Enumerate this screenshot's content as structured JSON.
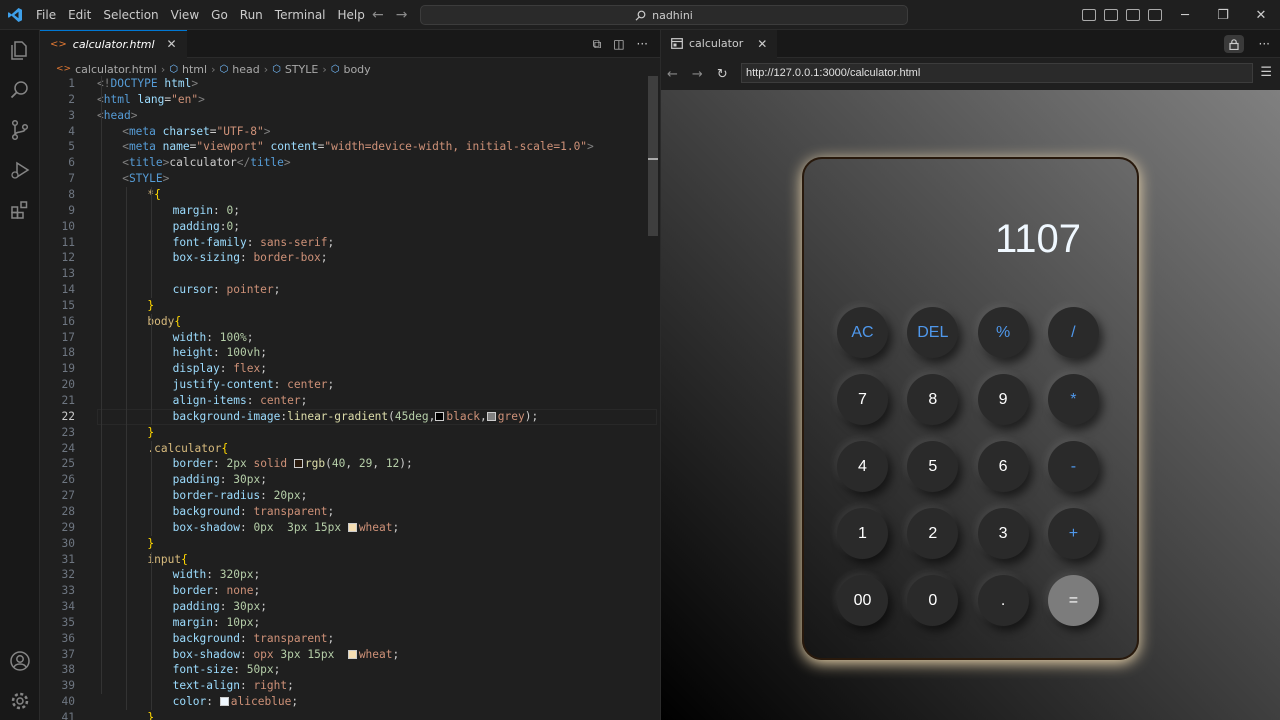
{
  "menu": [
    "File",
    "Edit",
    "Selection",
    "View",
    "Go",
    "Run",
    "Terminal",
    "Help"
  ],
  "command_center": {
    "label": "nadhini"
  },
  "editor": {
    "tab_label": "calculator.html",
    "breadcrumb": [
      "calculator.html",
      "html",
      "head",
      "STYLE",
      "body"
    ],
    "active_line": 22,
    "lines": [
      {
        "n": 1,
        "i": 0,
        "t": [
          [
            "t-punc",
            "<!"
          ],
          [
            "t-tag",
            "DOCTYPE"
          ],
          [
            "t-txt",
            " "
          ],
          [
            "t-attr",
            "html"
          ],
          [
            "t-punc",
            ">"
          ]
        ]
      },
      {
        "n": 2,
        "i": 0,
        "t": [
          [
            "t-punc",
            "<"
          ],
          [
            "t-tag",
            "html"
          ],
          [
            "t-txt",
            " "
          ],
          [
            "t-attr",
            "lang"
          ],
          [
            "t-txt",
            "="
          ],
          [
            "t-str",
            "\"en\""
          ],
          [
            "t-punc",
            ">"
          ]
        ]
      },
      {
        "n": 3,
        "i": 0,
        "t": [
          [
            "t-punc",
            "<"
          ],
          [
            "t-tag",
            "head"
          ],
          [
            "t-punc",
            ">"
          ]
        ]
      },
      {
        "n": 4,
        "i": 1,
        "t": [
          [
            "t-punc",
            "<"
          ],
          [
            "t-tag",
            "meta"
          ],
          [
            "t-txt",
            " "
          ],
          [
            "t-attr",
            "charset"
          ],
          [
            "t-txt",
            "="
          ],
          [
            "t-str",
            "\"UTF-8\""
          ],
          [
            "t-punc",
            ">"
          ]
        ]
      },
      {
        "n": 5,
        "i": 1,
        "t": [
          [
            "t-punc",
            "<"
          ],
          [
            "t-tag",
            "meta"
          ],
          [
            "t-txt",
            " "
          ],
          [
            "t-attr",
            "name"
          ],
          [
            "t-txt",
            "="
          ],
          [
            "t-str",
            "\"viewport\""
          ],
          [
            "t-txt",
            " "
          ],
          [
            "t-attr",
            "content"
          ],
          [
            "t-txt",
            "="
          ],
          [
            "t-str",
            "\"width=device-width, initial-scale=1.0\""
          ],
          [
            "t-punc",
            ">"
          ]
        ]
      },
      {
        "n": 6,
        "i": 1,
        "t": [
          [
            "t-punc",
            "<"
          ],
          [
            "t-tag",
            "title"
          ],
          [
            "t-punc",
            ">"
          ],
          [
            "t-txt",
            "calculator"
          ],
          [
            "t-punc",
            "</"
          ],
          [
            "t-tag",
            "title"
          ],
          [
            "t-punc",
            ">"
          ]
        ]
      },
      {
        "n": 7,
        "i": 1,
        "t": [
          [
            "t-punc",
            "<"
          ],
          [
            "t-tag",
            "STYLE"
          ],
          [
            "t-punc",
            ">"
          ]
        ]
      },
      {
        "n": 8,
        "i": 2,
        "t": [
          [
            "t-sel",
            "*"
          ],
          [
            "t-br",
            "{"
          ]
        ]
      },
      {
        "n": 9,
        "i": 3,
        "t": [
          [
            "t-prop",
            "margin"
          ],
          [
            "t-txt",
            ": "
          ],
          [
            "t-num",
            "0"
          ],
          [
            "t-txt",
            ";"
          ]
        ]
      },
      {
        "n": 10,
        "i": 3,
        "t": [
          [
            "t-prop",
            "padding"
          ],
          [
            "t-txt",
            ":"
          ],
          [
            "t-num",
            "0"
          ],
          [
            "t-txt",
            ";"
          ]
        ]
      },
      {
        "n": 11,
        "i": 3,
        "t": [
          [
            "t-prop",
            "font-family"
          ],
          [
            "t-txt",
            ": "
          ],
          [
            "t-val",
            "sans-serif"
          ],
          [
            "t-txt",
            ";"
          ]
        ]
      },
      {
        "n": 12,
        "i": 3,
        "t": [
          [
            "t-prop",
            "box-sizing"
          ],
          [
            "t-txt",
            ": "
          ],
          [
            "t-val",
            "border-box"
          ],
          [
            "t-txt",
            ";"
          ]
        ]
      },
      {
        "n": 13,
        "i": 3,
        "t": []
      },
      {
        "n": 14,
        "i": 3,
        "t": [
          [
            "t-prop",
            "cursor"
          ],
          [
            "t-txt",
            ": "
          ],
          [
            "t-val",
            "pointer"
          ],
          [
            "t-txt",
            ";"
          ]
        ]
      },
      {
        "n": 15,
        "i": 2,
        "t": [
          [
            "t-br",
            "}"
          ]
        ]
      },
      {
        "n": 16,
        "i": 2,
        "t": [
          [
            "t-sel",
            "body"
          ],
          [
            "t-br",
            "{"
          ]
        ]
      },
      {
        "n": 17,
        "i": 3,
        "t": [
          [
            "t-prop",
            "width"
          ],
          [
            "t-txt",
            ": "
          ],
          [
            "t-num",
            "100%"
          ],
          [
            "t-txt",
            ";"
          ]
        ]
      },
      {
        "n": 18,
        "i": 3,
        "t": [
          [
            "t-prop",
            "height"
          ],
          [
            "t-txt",
            ": "
          ],
          [
            "t-num",
            "100vh"
          ],
          [
            "t-txt",
            ";"
          ]
        ]
      },
      {
        "n": 19,
        "i": 3,
        "t": [
          [
            "t-prop",
            "display"
          ],
          [
            "t-txt",
            ": "
          ],
          [
            "t-val",
            "flex"
          ],
          [
            "t-txt",
            ";"
          ]
        ]
      },
      {
        "n": 20,
        "i": 3,
        "t": [
          [
            "t-prop",
            "justify-content"
          ],
          [
            "t-txt",
            ": "
          ],
          [
            "t-val",
            "center"
          ],
          [
            "t-txt",
            ";"
          ]
        ]
      },
      {
        "n": 21,
        "i": 3,
        "t": [
          [
            "t-prop",
            "align-items"
          ],
          [
            "t-txt",
            ": "
          ],
          [
            "t-val",
            "center"
          ],
          [
            "t-txt",
            ";"
          ]
        ]
      },
      {
        "n": 22,
        "i": 3,
        "t": [
          [
            "t-prop",
            "background-image"
          ],
          [
            "t-txt",
            ":"
          ],
          [
            "t-fn",
            "linear-gradient"
          ],
          [
            "t-txt",
            "("
          ],
          [
            "t-num",
            "45deg"
          ],
          [
            "t-txt",
            ","
          ],
          [
            "sw",
            "#000000"
          ],
          [
            "t-val",
            "black"
          ],
          [
            "t-txt",
            ","
          ],
          [
            "sw",
            "#808080"
          ],
          [
            "t-val",
            "grey"
          ],
          [
            "t-txt",
            ");"
          ]
        ]
      },
      {
        "n": 23,
        "i": 2,
        "t": [
          [
            "t-br",
            "}"
          ]
        ]
      },
      {
        "n": 24,
        "i": 2,
        "t": [
          [
            "t-sel",
            ".calculator"
          ],
          [
            "t-br",
            "{"
          ]
        ]
      },
      {
        "n": 25,
        "i": 3,
        "t": [
          [
            "t-prop",
            "border"
          ],
          [
            "t-txt",
            ": "
          ],
          [
            "t-num",
            "2px"
          ],
          [
            "t-txt",
            " "
          ],
          [
            "t-val",
            "solid"
          ],
          [
            "t-txt",
            " "
          ],
          [
            "sw",
            "#28190c"
          ],
          [
            "t-fn",
            "rgb"
          ],
          [
            "t-txt",
            "("
          ],
          [
            "t-num",
            "40"
          ],
          [
            "t-txt",
            ", "
          ],
          [
            "t-num",
            "29"
          ],
          [
            "t-txt",
            ", "
          ],
          [
            "t-num",
            "12"
          ],
          [
            "t-txt",
            ");"
          ]
        ]
      },
      {
        "n": 26,
        "i": 3,
        "t": [
          [
            "t-prop",
            "padding"
          ],
          [
            "t-txt",
            ": "
          ],
          [
            "t-num",
            "30px"
          ],
          [
            "t-txt",
            ";"
          ]
        ]
      },
      {
        "n": 27,
        "i": 3,
        "t": [
          [
            "t-prop",
            "border-radius"
          ],
          [
            "t-txt",
            ": "
          ],
          [
            "t-num",
            "20px"
          ],
          [
            "t-txt",
            ";"
          ]
        ]
      },
      {
        "n": 28,
        "i": 3,
        "t": [
          [
            "t-prop",
            "background"
          ],
          [
            "t-txt",
            ": "
          ],
          [
            "t-val",
            "transparent"
          ],
          [
            "t-txt",
            ";"
          ]
        ]
      },
      {
        "n": 29,
        "i": 3,
        "t": [
          [
            "t-prop",
            "box-shadow"
          ],
          [
            "t-txt",
            ": "
          ],
          [
            "t-num",
            "0px"
          ],
          [
            "t-txt",
            "  "
          ],
          [
            "t-num",
            "3px"
          ],
          [
            "t-txt",
            " "
          ],
          [
            "t-num",
            "15px"
          ],
          [
            "t-txt",
            " "
          ],
          [
            "sw",
            "#f5deb3"
          ],
          [
            "t-val",
            "wheat"
          ],
          [
            "t-txt",
            ";"
          ]
        ]
      },
      {
        "n": 30,
        "i": 2,
        "t": [
          [
            "t-br",
            "}"
          ]
        ]
      },
      {
        "n": 31,
        "i": 2,
        "t": [
          [
            "t-sel",
            "input"
          ],
          [
            "t-br",
            "{"
          ]
        ]
      },
      {
        "n": 32,
        "i": 3,
        "t": [
          [
            "t-prop",
            "width"
          ],
          [
            "t-txt",
            ": "
          ],
          [
            "t-num",
            "320px"
          ],
          [
            "t-txt",
            ";"
          ]
        ]
      },
      {
        "n": 33,
        "i": 3,
        "t": [
          [
            "t-prop",
            "border"
          ],
          [
            "t-txt",
            ": "
          ],
          [
            "t-val",
            "none"
          ],
          [
            "t-txt",
            ";"
          ]
        ]
      },
      {
        "n": 34,
        "i": 3,
        "t": [
          [
            "t-prop",
            "padding"
          ],
          [
            "t-txt",
            ": "
          ],
          [
            "t-num",
            "30px"
          ],
          [
            "t-txt",
            ";"
          ]
        ]
      },
      {
        "n": 35,
        "i": 3,
        "t": [
          [
            "t-prop",
            "margin"
          ],
          [
            "t-txt",
            ": "
          ],
          [
            "t-num",
            "10px"
          ],
          [
            "t-txt",
            ";"
          ]
        ]
      },
      {
        "n": 36,
        "i": 3,
        "t": [
          [
            "t-prop",
            "background"
          ],
          [
            "t-txt",
            ": "
          ],
          [
            "t-val",
            "transparent"
          ],
          [
            "t-txt",
            ";"
          ]
        ]
      },
      {
        "n": 37,
        "i": 3,
        "t": [
          [
            "t-prop",
            "box-shadow"
          ],
          [
            "t-txt",
            ": "
          ],
          [
            "t-val",
            "opx"
          ],
          [
            "t-txt",
            " "
          ],
          [
            "t-num",
            "3px"
          ],
          [
            "t-txt",
            " "
          ],
          [
            "t-num",
            "15px"
          ],
          [
            "t-txt",
            "  "
          ],
          [
            "sw",
            "#f5deb3"
          ],
          [
            "t-val",
            "wheat"
          ],
          [
            "t-txt",
            ";"
          ]
        ]
      },
      {
        "n": 38,
        "i": 3,
        "t": [
          [
            "t-prop",
            "font-size"
          ],
          [
            "t-txt",
            ": "
          ],
          [
            "t-num",
            "50px"
          ],
          [
            "t-txt",
            ";"
          ]
        ]
      },
      {
        "n": 39,
        "i": 3,
        "t": [
          [
            "t-prop",
            "text-align"
          ],
          [
            "t-txt",
            ": "
          ],
          [
            "t-val",
            "right"
          ],
          [
            "t-txt",
            ";"
          ]
        ]
      },
      {
        "n": 40,
        "i": 3,
        "t": [
          [
            "t-prop",
            "color"
          ],
          [
            "t-txt",
            ": "
          ],
          [
            "sw",
            "#f0f8ff"
          ],
          [
            "t-val",
            "aliceblue"
          ],
          [
            "t-txt",
            ";"
          ]
        ]
      },
      {
        "n": 41,
        "i": 2,
        "t": [
          [
            "t-br",
            "}"
          ]
        ]
      }
    ]
  },
  "browser": {
    "tab_label": "calculator",
    "url": "http://127.0.0.1:3000/calculator.html"
  },
  "calculator": {
    "display": "1107",
    "rows": [
      [
        {
          "label": "AC",
          "kind": "op"
        },
        {
          "label": "DEL",
          "kind": "op"
        },
        {
          "label": "%",
          "kind": "op"
        },
        {
          "label": "/",
          "kind": "op"
        }
      ],
      [
        {
          "label": "7",
          "kind": "num"
        },
        {
          "label": "8",
          "kind": "num"
        },
        {
          "label": "9",
          "kind": "num"
        },
        {
          "label": "*",
          "kind": "op"
        }
      ],
      [
        {
          "label": "4",
          "kind": "num"
        },
        {
          "label": "5",
          "kind": "num"
        },
        {
          "label": "6",
          "kind": "num"
        },
        {
          "label": "-",
          "kind": "op"
        }
      ],
      [
        {
          "label": "1",
          "kind": "num"
        },
        {
          "label": "2",
          "kind": "num"
        },
        {
          "label": "3",
          "kind": "num"
        },
        {
          "label": "+",
          "kind": "op"
        }
      ],
      [
        {
          "label": "00",
          "kind": "num"
        },
        {
          "label": "0",
          "kind": "num"
        },
        {
          "label": ".",
          "kind": "num"
        },
        {
          "label": "=",
          "kind": "eq"
        }
      ]
    ]
  },
  "colors": {
    "accent": "#0078d4",
    "operator_key": "#4f98ec",
    "equals_key": "#7c7c7c",
    "calculator_glow": "#f5deb3"
  }
}
